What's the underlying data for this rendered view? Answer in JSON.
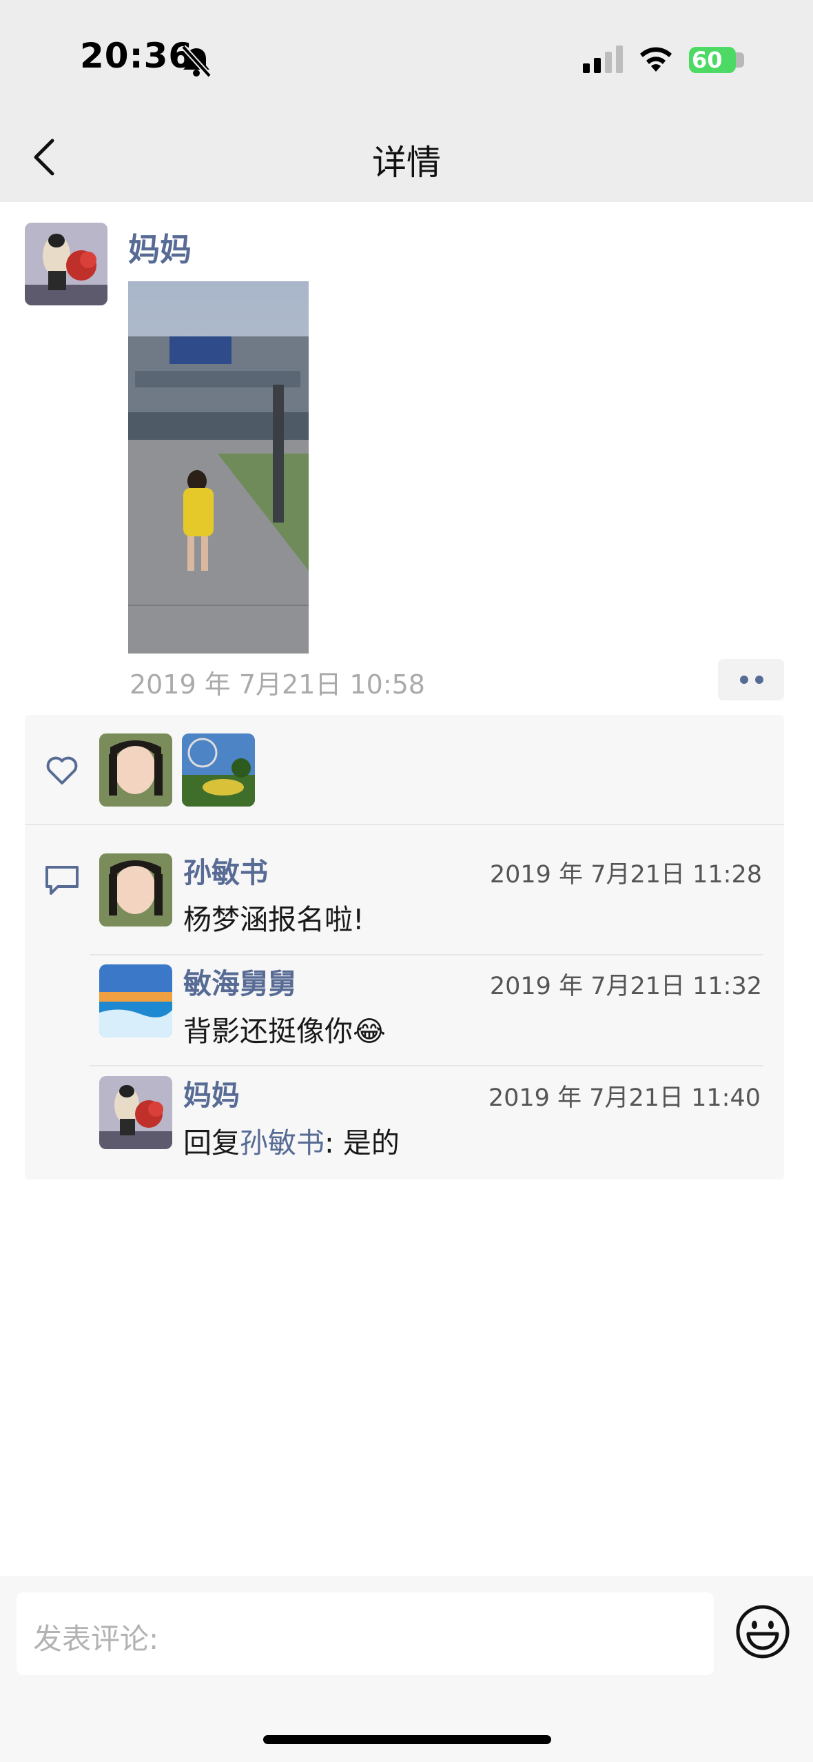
{
  "status_bar": {
    "time": "20:36",
    "battery": "60"
  },
  "nav": {
    "title": "详情",
    "back_icon": "chevron-left-icon"
  },
  "post": {
    "author": "妈妈",
    "time": "2019 年 7月21日 10:58",
    "more_icon": "more-dots-icon"
  },
  "likes": {
    "icon": "heart-icon"
  },
  "comments_icon": "comment-bubble-icon",
  "comments": [
    {
      "name": "孙敏书",
      "time": "2019 年 7月21日 11:28",
      "text": "杨梦涵报名啦!"
    },
    {
      "name": "敏海舅舅",
      "time": "2019 年 7月21日 11:32",
      "text": "背影还挺像你",
      "emoji": "😂"
    },
    {
      "name": "妈妈",
      "time": "2019 年 7月21日 11:40",
      "reply_prefix": "回复",
      "reply_to": "孙敏书",
      "text": ": 是的"
    }
  ],
  "composer": {
    "placeholder": "发表评论:",
    "emoji_icon": "smiley-icon"
  },
  "colors": {
    "link": "#576b95",
    "bar": "#ededed",
    "battery": "#4cd964"
  }
}
